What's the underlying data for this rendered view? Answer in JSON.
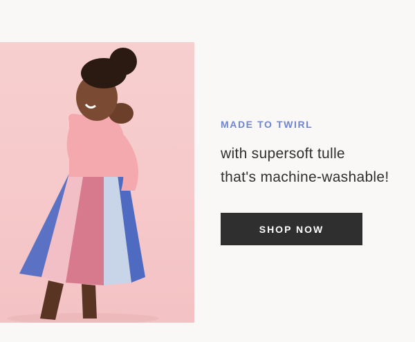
{
  "promo": {
    "eyebrow": "MADE TO TWIRL",
    "headline_line1": "with supersoft tulle",
    "headline_line2": "that's machine-washable!",
    "cta_label": "SHOP NOW"
  },
  "colors": {
    "background": "#f9f8f6",
    "eyebrow": "#6f86cf",
    "text": "#2f2f2f",
    "button": "#2f2f2f",
    "photo_backdrop": "#f7cfcf"
  }
}
